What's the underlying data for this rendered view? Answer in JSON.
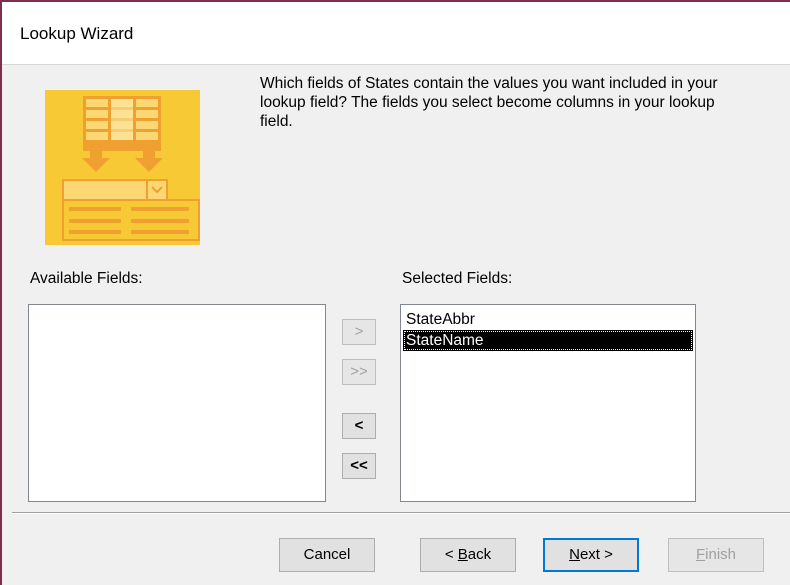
{
  "window": {
    "title": "Lookup Wizard"
  },
  "instruction": "Which fields of States contain the values you want included in your\nlookup field? The fields you select become columns in your lookup\nfield.",
  "available": {
    "label": "Available Fields:",
    "items": []
  },
  "selected": {
    "label": "Selected Fields:",
    "items": [
      "StateAbbr",
      "StateName"
    ],
    "highlighted": "StateName"
  },
  "move_buttons": {
    "add_one": ">",
    "add_all": ">>",
    "remove_one": "<",
    "remove_all": "<<"
  },
  "footer": {
    "cancel": "Cancel",
    "back_prefix": "< ",
    "back_accel": "B",
    "back_rest": "ack",
    "next_accel": "N",
    "next_rest": "ext >",
    "finish_accel": "F",
    "finish_rest": "inish"
  },
  "colors": {
    "art_yellow": "#f7c934",
    "art_orange": "#f0a030",
    "default_button_border": "#0078d7",
    "selection": "#000000"
  },
  "icons": {
    "wizard_art": "table-lookup-art"
  }
}
